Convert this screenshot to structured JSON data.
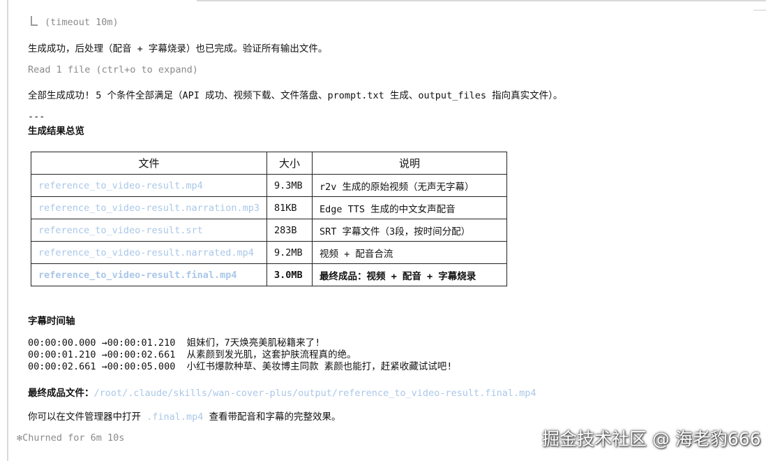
{
  "header": {
    "timeout_text": "(timeout 10m)"
  },
  "messages": {
    "success_note": "生成成功，后处理（配音 + 字幕烧录）也已完成。验证所有输出文件。",
    "read_files": "Read 1 file (ctrl+o to expand)",
    "all_success": "全部生成成功! 5 个条件全部满足（API 成功、视频下载、文件落盘、prompt.txt 生成、output_files 指向真实文件）。",
    "separator": "---",
    "summary_heading": "生成结果总览"
  },
  "table": {
    "headers": [
      "文件",
      "大小",
      "说明"
    ],
    "rows": [
      {
        "file": "reference_to_video-result.mp4",
        "size": "9.3MB",
        "desc": "r2v 生成的原始视频（无声无字幕）"
      },
      {
        "file": "reference_to_video-result.narration.mp3",
        "size": "81KB",
        "desc": "Edge TTS 生成的中文女声配音"
      },
      {
        "file": "reference_to_video-result.srt",
        "size": "283B",
        "desc": "SRT 字幕文件（3段，按时间分配）"
      },
      {
        "file": "reference_to_video-result.narrated.mp4",
        "size": "9.2MB",
        "desc": "视频 + 配音合流"
      },
      {
        "file": "reference_to_video-result.final.mp4",
        "size": "3.0MB",
        "desc": "最终成品：视频 + 配音 + 字幕烧录"
      }
    ]
  },
  "timeline": {
    "heading": "字幕时间轴",
    "lines": [
      "00:00:00.000 →00:00:01.210  姐妹们，7天焕亮美肌秘籍来了!",
      "00:00:01.210 →00:00:02.661  从素颜到发光肌，这套护肤流程真的绝。",
      "00:00:02.661 →00:00:05.000  小红书爆款种草、美妆博主同款 素颜也能打，赶紧收藏试试吧!"
    ]
  },
  "final_file": {
    "label": "最终成品文件：",
    "path": "/root/.claude/skills/wan-cover-plus/output/reference_to_video-result.final.mp4"
  },
  "open_hint": {
    "prefix": "你可以在文件管理器中打开",
    "file": ".final.mp4",
    "suffix": "查看带配音和字幕的完整效果。"
  },
  "status": {
    "spinner_icon": "✻",
    "text": "Churned for 6m 10s"
  },
  "watermark": "掘金技术社区 @ 海老豹666"
}
